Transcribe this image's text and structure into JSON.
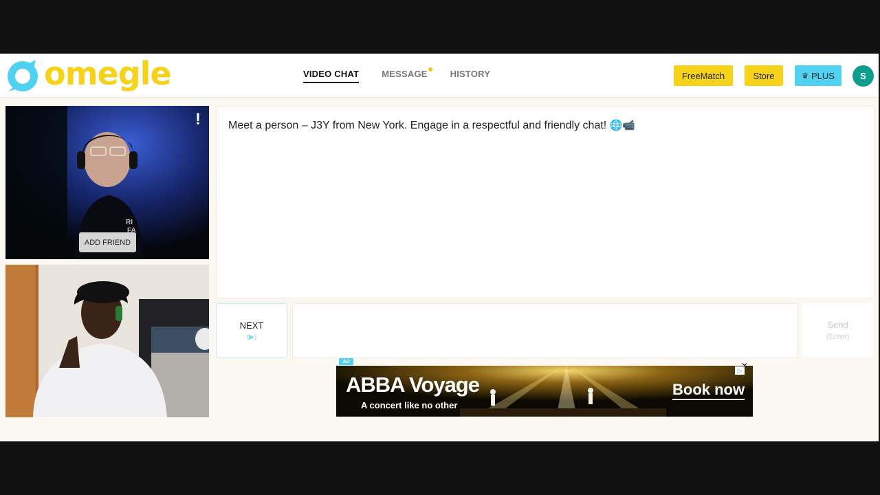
{
  "app": {
    "logo_text": "omegle",
    "brand_yellow": "#f7d21a",
    "brand_cyan": "#4fd1f2"
  },
  "nav": {
    "items": [
      {
        "label": "VIDEO CHAT",
        "active": true
      },
      {
        "label": "MESSAGE",
        "has_notification": true
      },
      {
        "label": "HISTORY"
      }
    ]
  },
  "header_buttons": {
    "freematch": "FreeMatch",
    "store": "Store",
    "plus": "PLUS",
    "plus_icon": "crown-icon"
  },
  "user": {
    "avatar_initial": "S",
    "avatar_color": "#0f9e8e"
  },
  "stranger_video": {
    "report_icon": "!",
    "add_friend_label": "ADD FRIEND"
  },
  "chat": {
    "message": "Meet a person – J3Y from New York. Engage in a respectful and friendly chat! ",
    "emojis": "🌐📹",
    "next_label": "NEXT",
    "next_hint": "(▶)",
    "send_label": "Send",
    "send_hint": "(Enter)",
    "input_value": ""
  },
  "ad": {
    "badge": "AD",
    "title": "ABBA Voyage",
    "tagline": "A concert like no other",
    "cta": "Book now",
    "close": "✕",
    "info": "▷"
  }
}
